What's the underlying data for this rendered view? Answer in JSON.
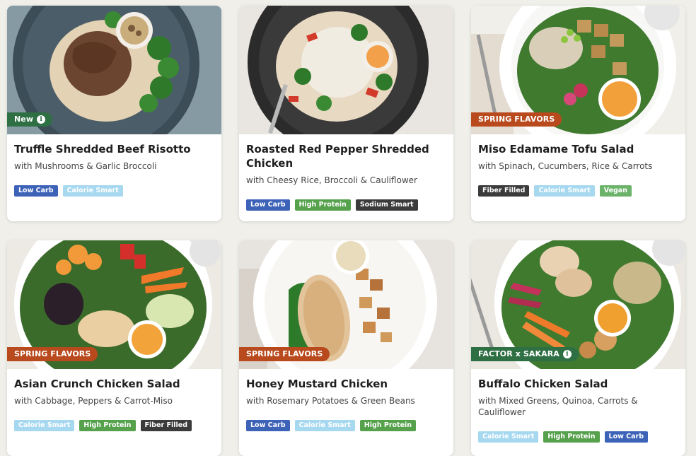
{
  "colors": {
    "page_background": "#f0efea",
    "new_badge": "#2e6f44",
    "spring_badge": "#b94a1e",
    "partner_badge": "#2e6f44",
    "tag_low_carb": "#3d63b8",
    "tag_calorie_smart": "#a6d8f0",
    "tag_high_protein": "#56a14c",
    "tag_sodium_smart": "#3b3b3b",
    "tag_fiber_filled": "#3b3b3b",
    "tag_vegan": "#6cb36a"
  },
  "meals": [
    {
      "title": "Truffle Shredded Beef Risotto",
      "subtitle": "with Mushrooms & Garlic Broccoli",
      "badge": {
        "label": "New",
        "style": "new",
        "info_icon": true
      },
      "tags": [
        {
          "label": "Low Carb",
          "style": "low-carb"
        },
        {
          "label": "Calorie Smart",
          "style": "calorie-smart"
        }
      ]
    },
    {
      "title": "Roasted Red Pepper Shredded Chicken",
      "subtitle": "with Cheesy Rice, Broccoli & Cauliflower",
      "badge": null,
      "tags": [
        {
          "label": "Low Carb",
          "style": "low-carb"
        },
        {
          "label": "High Protein",
          "style": "high-protein"
        },
        {
          "label": "Sodium Smart",
          "style": "sodium-smart"
        }
      ]
    },
    {
      "title": "Miso Edamame Tofu Salad",
      "subtitle": "with Spinach, Cucumbers, Rice & Carrots",
      "badge": {
        "label": "SPRING FLAVORS",
        "style": "spring",
        "info_icon": false
      },
      "tags": [
        {
          "label": "Fiber Filled",
          "style": "fiber-filled"
        },
        {
          "label": "Calorie Smart",
          "style": "calorie-smart"
        },
        {
          "label": "Vegan",
          "style": "vegan"
        }
      ]
    },
    {
      "title": "Asian Crunch Chicken Salad",
      "subtitle": "with Cabbage, Peppers & Carrot-Miso",
      "badge": {
        "label": "SPRING FLAVORS",
        "style": "spring",
        "info_icon": false
      },
      "tags": [
        {
          "label": "Calorie Smart",
          "style": "calorie-smart"
        },
        {
          "label": "High Protein",
          "style": "high-protein"
        },
        {
          "label": "Fiber Filled",
          "style": "fiber-filled"
        }
      ]
    },
    {
      "title": "Honey Mustard Chicken",
      "subtitle": "with Rosemary Potatoes & Green Beans",
      "badge": {
        "label": "SPRING FLAVORS",
        "style": "spring",
        "info_icon": false
      },
      "tags": [
        {
          "label": "Low Carb",
          "style": "low-carb"
        },
        {
          "label": "Calorie Smart",
          "style": "calorie-smart"
        },
        {
          "label": "High Protein",
          "style": "high-protein"
        }
      ]
    },
    {
      "title": "Buffalo Chicken Salad",
      "subtitle": "with Mixed Greens, Quinoa, Carrots & Cauliflower",
      "badge": {
        "label": "FACTOR x SAKARA",
        "style": "partner",
        "info_icon": true
      },
      "tags": [
        {
          "label": "Calorie Smart",
          "style": "calorie-smart"
        },
        {
          "label": "High Protein",
          "style": "high-protein"
        },
        {
          "label": "Low Carb",
          "style": "low-carb"
        }
      ]
    }
  ]
}
